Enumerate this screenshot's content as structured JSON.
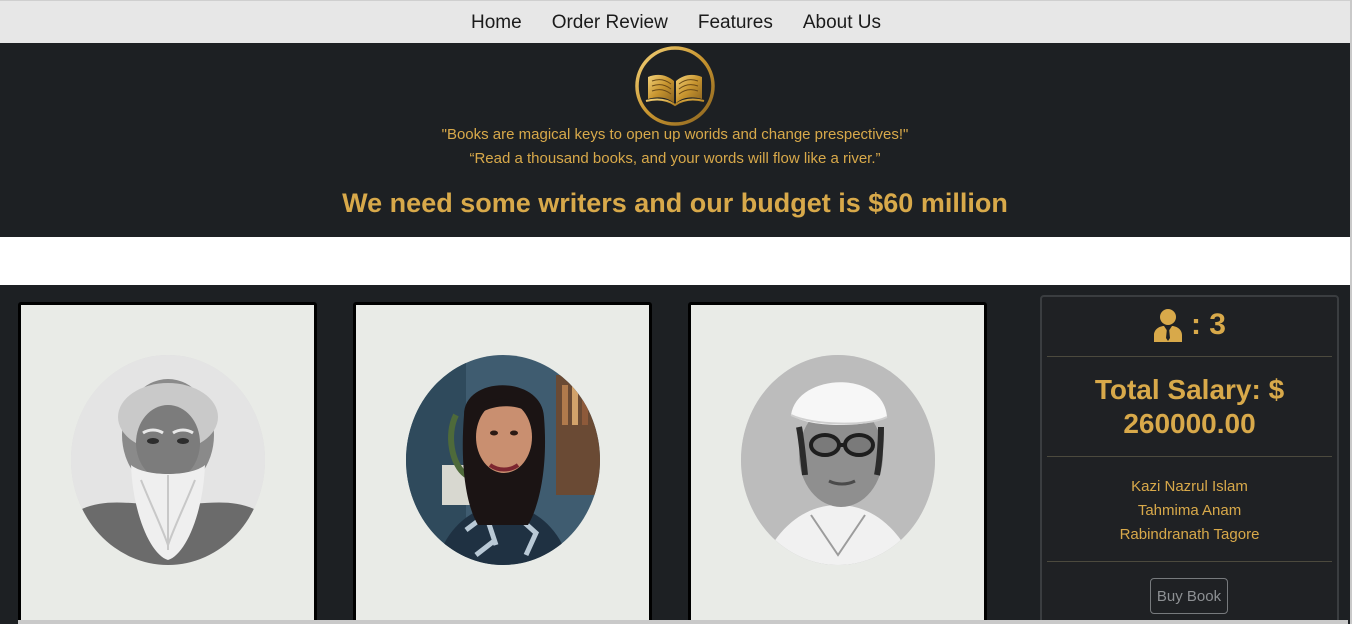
{
  "nav": {
    "items": [
      {
        "label": "Home"
      },
      {
        "label": "Order Review"
      },
      {
        "label": "Features"
      },
      {
        "label": "About Us"
      }
    ]
  },
  "header": {
    "logo_icon": "book-logo-icon",
    "quote1": "\"Books are magical keys to open up worids and change prespectives!\"",
    "quote2": "“Read a thousand books, and your words will flow like a river.”",
    "headline": "We need some writers and our budget is $60 million"
  },
  "cards": [
    {
      "portrait": "writer-portrait-bearded-elder"
    },
    {
      "portrait": "writer-portrait-woman"
    },
    {
      "portrait": "writer-portrait-cap-glasses"
    }
  ],
  "summary": {
    "person_icon": "person-icon",
    "count_text": ": 3",
    "salary_text": "Total Salary: $ 260000.00",
    "names": [
      "Kazi Nazrul Islam",
      "Tahmima Anam",
      "Rabindranath Tagore"
    ],
    "buy_label": "Buy Book"
  },
  "colors": {
    "accent": "#d8a94a",
    "dark_bg": "#1d2023",
    "nav_bg": "#e7e7e7",
    "card_bg": "#e9ebe7"
  }
}
